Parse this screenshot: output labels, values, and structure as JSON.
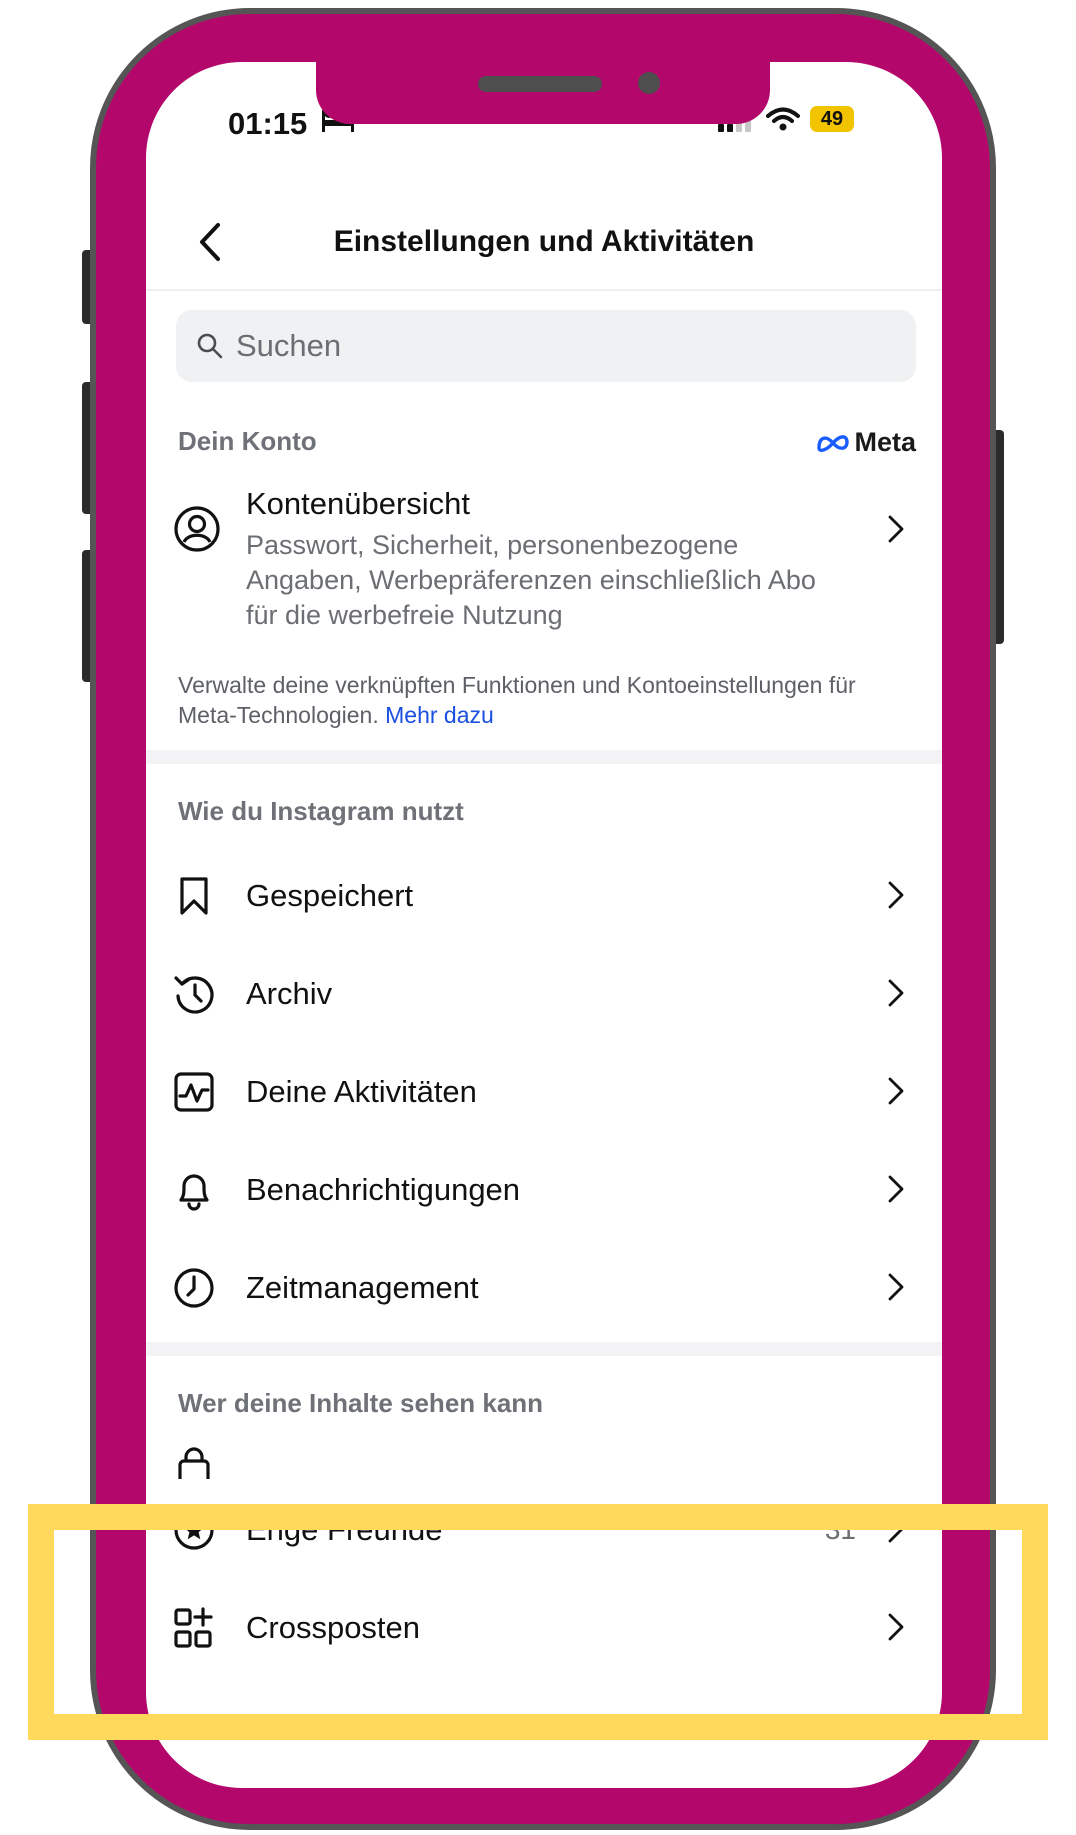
{
  "status_bar": {
    "time": "01:15",
    "battery": "49"
  },
  "header": {
    "title": "Einstellungen und Aktivitäten"
  },
  "search": {
    "placeholder": "Suchen"
  },
  "account_section": {
    "label": "Dein Konto",
    "brand": "Meta",
    "overview": {
      "title": "Kontenübersicht",
      "description": "Passwort, Sicherheit, personenbezogene Angaben, Werbepräferenzen einschließlich Abo für die werbefreie Nutzung"
    },
    "note": "Verwalte deine verknüpften Funktionen und Kontoeinstellungen für Meta-Technologien.",
    "note_link": "Mehr dazu"
  },
  "usage_section": {
    "label": "Wie du Instagram nutzt",
    "items": [
      {
        "label": "Gespeichert",
        "icon": "bookmark-icon"
      },
      {
        "label": "Archiv",
        "icon": "archive-history-icon"
      },
      {
        "label": "Deine Aktivitäten",
        "icon": "activity-chart-icon"
      },
      {
        "label": "Benachrichtigungen",
        "icon": "bell-icon"
      },
      {
        "label": "Zeitmanagement",
        "icon": "clock-icon"
      }
    ]
  },
  "visibility_section": {
    "label": "Wer deine Inhalte sehen kann",
    "items": [
      {
        "label": "Enge Freunde",
        "count": "31",
        "icon": "star-circle-icon"
      },
      {
        "label": "Crossposten",
        "icon": "crosspost-icon"
      }
    ]
  },
  "colors": {
    "frame": "#b4076b",
    "highlight": "#ffd95c",
    "link": "#1a4fe0"
  }
}
